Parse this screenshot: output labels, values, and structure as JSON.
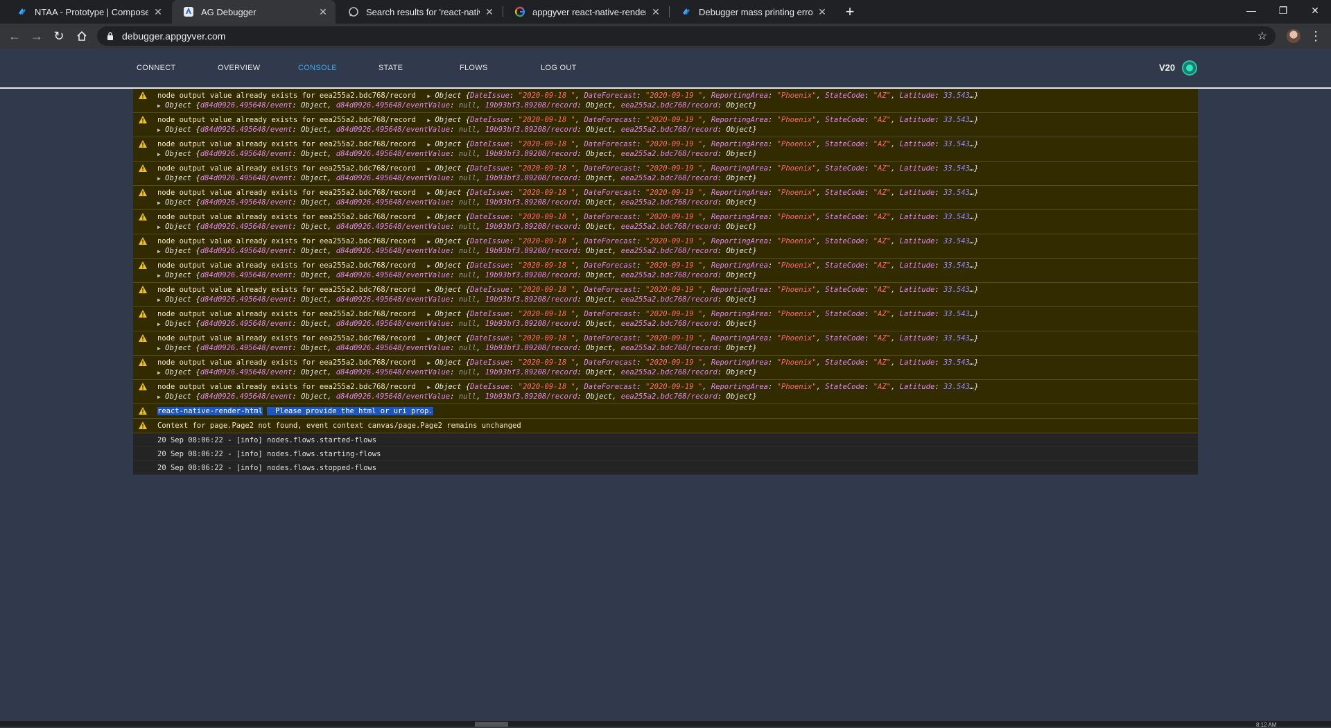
{
  "browser": {
    "tabs": [
      {
        "title": "NTAA - Prototype | Composer Pr",
        "icon": "appgyver-icon"
      },
      {
        "title": "AG Debugger",
        "icon": "appgyver-debugger-icon"
      },
      {
        "title": "Search results for 'react-native-re",
        "icon": "forum-icon"
      },
      {
        "title": "appgyver react-native-render-htm",
        "icon": "google-icon"
      },
      {
        "title": "Debugger mass printing errors fo",
        "icon": "appgyver-icon"
      }
    ],
    "active_tab": 1,
    "url": "debugger.appgyver.com"
  },
  "nav": {
    "items": [
      "CONNECT",
      "OVERVIEW",
      "CONSOLE",
      "STATE",
      "FLOWS",
      "LOG OUT"
    ],
    "active": "CONSOLE",
    "version": "V20"
  },
  "warning_entry": {
    "message": "node output value already exists for eea255a2.bdc768/record",
    "obj_label": "Object",
    "obj1": {
      "k1": "DateIssue",
      "v1": "\"2020-09-18 \"",
      "k2": "DateForecast",
      "v2": "\"2020-09-19 \"",
      "k3": "ReportingArea",
      "v3": "\"Phoenix\"",
      "k4": "StateCode",
      "v4": "\"AZ\"",
      "k5": "Latitude",
      "v5": "33.543",
      "ellipsis": "…}"
    },
    "obj2": {
      "k1": "d84d0926.495648/event",
      "v1": "Object",
      "k2": "d84d0926.495648/eventValue",
      "v2": "null",
      "k3": "19b93bf3.89208/record",
      "v3": "Object",
      "k4": "eea255a2.bdc768/record",
      "v4": "Object"
    },
    "repeat_count": 13
  },
  "render_warning": {
    "part1": "react-native-render-html",
    "part2": "Please provide the html or uri prop."
  },
  "context_warning": "Context for page.Page2 not found, event context canvas/page.Page2 remains unchanged",
  "info_logs": [
    "20 Sep 08:06:22 - [info] nodes.flows.started-flows",
    "20 Sep 08:06:22 - [info] nodes.flows.starting-flows",
    "20 Sep 08:06:22 - [info] nodes.flows.stopped-flows"
  ],
  "taskbar_clock": "8:12 AM",
  "colors": {
    "accent": "#3fa9f5",
    "warning_bg": "#332b00",
    "status": "#2ee6c0",
    "page_bg": "#303a4c"
  }
}
